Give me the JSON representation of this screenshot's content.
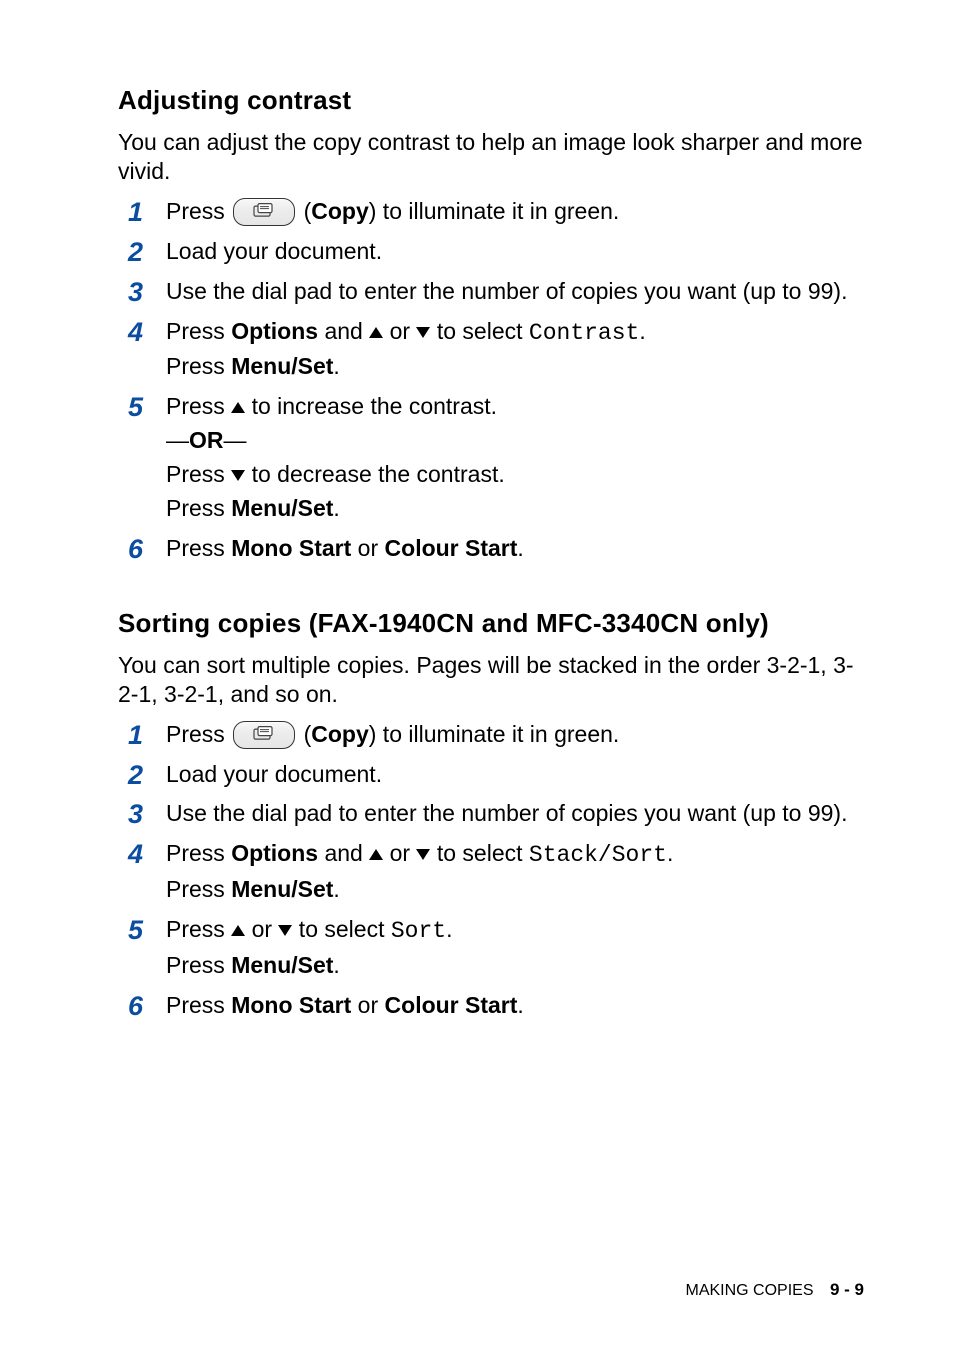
{
  "section1": {
    "heading": "Adjusting contrast",
    "intro": "You can adjust the copy contrast to help an image look sharper and more vivid.",
    "steps": [
      {
        "num": "1",
        "lines": [
          {
            "parts": [
              {
                "t": "text",
                "v": "Press "
              },
              {
                "t": "copybtn"
              },
              {
                "t": "text",
                "v": " ("
              },
              {
                "t": "bold",
                "v": "Copy"
              },
              {
                "t": "text",
                "v": ") to illuminate it in green."
              }
            ]
          }
        ]
      },
      {
        "num": "2",
        "lines": [
          {
            "parts": [
              {
                "t": "text",
                "v": "Load your document."
              }
            ]
          }
        ]
      },
      {
        "num": "3",
        "lines": [
          {
            "parts": [
              {
                "t": "text",
                "v": "Use the dial pad to enter the number of copies you want (up to 99)."
              }
            ]
          }
        ]
      },
      {
        "num": "4",
        "lines": [
          {
            "parts": [
              {
                "t": "text",
                "v": "Press "
              },
              {
                "t": "bold",
                "v": "Options"
              },
              {
                "t": "text",
                "v": " and "
              },
              {
                "t": "triup"
              },
              {
                "t": "text",
                "v": " or "
              },
              {
                "t": "tridown"
              },
              {
                "t": "text",
                "v": " to select "
              },
              {
                "t": "mono",
                "v": "Contrast"
              },
              {
                "t": "text",
                "v": "."
              }
            ]
          },
          {
            "parts": [
              {
                "t": "text",
                "v": "Press "
              },
              {
                "t": "bold",
                "v": "Menu/Set"
              },
              {
                "t": "text",
                "v": "."
              }
            ]
          }
        ]
      },
      {
        "num": "5",
        "lines": [
          {
            "parts": [
              {
                "t": "text",
                "v": "Press "
              },
              {
                "t": "triup"
              },
              {
                "t": "text",
                "v": " to increase the contrast."
              }
            ]
          },
          {
            "parts": [
              {
                "t": "text",
                "v": "—"
              },
              {
                "t": "bold",
                "v": "OR"
              },
              {
                "t": "text",
                "v": "—"
              }
            ]
          },
          {
            "parts": [
              {
                "t": "text",
                "v": "Press "
              },
              {
                "t": "tridown"
              },
              {
                "t": "text",
                "v": " to decrease the contrast."
              }
            ]
          },
          {
            "parts": [
              {
                "t": "text",
                "v": "Press "
              },
              {
                "t": "bold",
                "v": "Menu/Set"
              },
              {
                "t": "text",
                "v": "."
              }
            ]
          }
        ]
      },
      {
        "num": "6",
        "lines": [
          {
            "parts": [
              {
                "t": "text",
                "v": "Press "
              },
              {
                "t": "bold",
                "v": "Mono Start"
              },
              {
                "t": "text",
                "v": " or "
              },
              {
                "t": "bold",
                "v": "Colour Start"
              },
              {
                "t": "text",
                "v": "."
              }
            ]
          }
        ]
      }
    ]
  },
  "section2": {
    "heading": "Sorting copies (FAX-1940CN and MFC-3340CN only)",
    "intro": "You can sort multiple copies. Pages will be stacked in the order 3-2-1, 3-2-1, 3-2-1, and so on.",
    "steps": [
      {
        "num": "1",
        "lines": [
          {
            "parts": [
              {
                "t": "text",
                "v": "Press "
              },
              {
                "t": "copybtn"
              },
              {
                "t": "text",
                "v": " ("
              },
              {
                "t": "bold",
                "v": "Copy"
              },
              {
                "t": "text",
                "v": ") to illuminate it in green."
              }
            ]
          }
        ]
      },
      {
        "num": "2",
        "lines": [
          {
            "parts": [
              {
                "t": "text",
                "v": "Load your document."
              }
            ]
          }
        ]
      },
      {
        "num": "3",
        "lines": [
          {
            "parts": [
              {
                "t": "text",
                "v": "Use the dial pad to enter the number of copies you want (up to 99)."
              }
            ]
          }
        ]
      },
      {
        "num": "4",
        "lines": [
          {
            "parts": [
              {
                "t": "text",
                "v": "Press "
              },
              {
                "t": "bold",
                "v": "Options"
              },
              {
                "t": "text",
                "v": " and "
              },
              {
                "t": "triup"
              },
              {
                "t": "text",
                "v": " or "
              },
              {
                "t": "tridown"
              },
              {
                "t": "text",
                "v": " to select "
              },
              {
                "t": "mono",
                "v": "Stack/Sort"
              },
              {
                "t": "text",
                "v": "."
              }
            ]
          },
          {
            "parts": [
              {
                "t": "text",
                "v": "Press "
              },
              {
                "t": "bold",
                "v": "Menu/Set"
              },
              {
                "t": "text",
                "v": "."
              }
            ]
          }
        ]
      },
      {
        "num": "5",
        "lines": [
          {
            "parts": [
              {
                "t": "text",
                "v": "Press "
              },
              {
                "t": "triup"
              },
              {
                "t": "text",
                "v": " or "
              },
              {
                "t": "tridown"
              },
              {
                "t": "text",
                "v": " to select "
              },
              {
                "t": "mono",
                "v": "Sort"
              },
              {
                "t": "text",
                "v": "."
              }
            ]
          },
          {
            "parts": [
              {
                "t": "text",
                "v": "Press "
              },
              {
                "t": "bold",
                "v": "Menu/Set"
              },
              {
                "t": "text",
                "v": "."
              }
            ]
          }
        ]
      },
      {
        "num": "6",
        "lines": [
          {
            "parts": [
              {
                "t": "text",
                "v": "Press "
              },
              {
                "t": "bold",
                "v": "Mono Start"
              },
              {
                "t": "text",
                "v": " or "
              },
              {
                "t": "bold",
                "v": "Colour Start"
              },
              {
                "t": "text",
                "v": "."
              }
            ]
          }
        ]
      }
    ]
  },
  "footer": {
    "section": "MAKING COPIES",
    "page": "9 - 9"
  }
}
